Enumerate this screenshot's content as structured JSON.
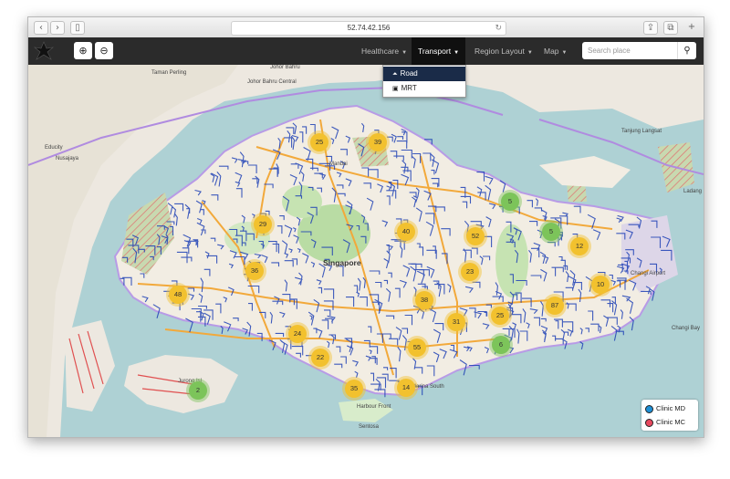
{
  "browser": {
    "back_icon": "chevron-left-icon",
    "forward_icon": "chevron-right-icon",
    "sidebar_icon": "sidebar-icon",
    "address": "52.74.42.156",
    "reload_icon": "reload-icon",
    "share_icon": "share-icon",
    "tabs_icon": "tabs-icon",
    "add_tab_icon": "plus-icon"
  },
  "navbar": {
    "zoom_in_icon": "zoom-in-icon",
    "zoom_out_icon": "zoom-out-icon",
    "menu": [
      {
        "label": "Healthcare",
        "active": false
      },
      {
        "label": "Transport",
        "active": true
      },
      {
        "label": "Region Layout",
        "active": false
      },
      {
        "label": "Map",
        "active": false
      }
    ],
    "search_placeholder": "Search place",
    "search_icon": "search-icon"
  },
  "transport_dropdown": [
    {
      "label": "Road",
      "icon": "road-icon",
      "selected": true
    },
    {
      "label": "MRT",
      "icon": "train-icon",
      "selected": false
    }
  ],
  "map": {
    "city_label": "Singapore",
    "place_labels": [
      "Taman Perling",
      "Johor Bahru",
      "Johor Bahru Central",
      "Nusajaya",
      "Educity",
      "Tanjung Langsat",
      "Mandai",
      "Changi Airport",
      "Changi Bay",
      "Sentosa",
      "Jurong Isl",
      "Marina South",
      "Harbour Front",
      "Ladang"
    ],
    "clusters": [
      {
        "count": "25",
        "color": "yellow"
      },
      {
        "count": "39",
        "color": "yellow"
      },
      {
        "count": "5",
        "color": "green"
      },
      {
        "count": "29",
        "color": "yellow"
      },
      {
        "count": "40",
        "color": "yellow"
      },
      {
        "count": "52",
        "color": "yellow"
      },
      {
        "count": "5",
        "color": "green"
      },
      {
        "count": "12",
        "color": "yellow"
      },
      {
        "count": "36",
        "color": "yellow"
      },
      {
        "count": "23",
        "color": "yellow"
      },
      {
        "count": "10",
        "color": "yellow"
      },
      {
        "count": "48",
        "color": "yellow"
      },
      {
        "count": "38",
        "color": "yellow"
      },
      {
        "count": "87",
        "color": "yellow"
      },
      {
        "count": "24",
        "color": "yellow"
      },
      {
        "count": "31",
        "color": "yellow"
      },
      {
        "count": "25",
        "color": "yellow"
      },
      {
        "count": "55",
        "color": "yellow"
      },
      {
        "count": "6",
        "color": "green"
      },
      {
        "count": "22",
        "color": "yellow"
      },
      {
        "count": "35",
        "color": "yellow"
      },
      {
        "count": "14",
        "color": "yellow"
      },
      {
        "count": "2",
        "color": "green"
      }
    ]
  },
  "legend": [
    {
      "label": "Clinic MD",
      "color": "#1e90d6"
    },
    {
      "label": "Clinic MC",
      "color": "#e8495f"
    }
  ]
}
